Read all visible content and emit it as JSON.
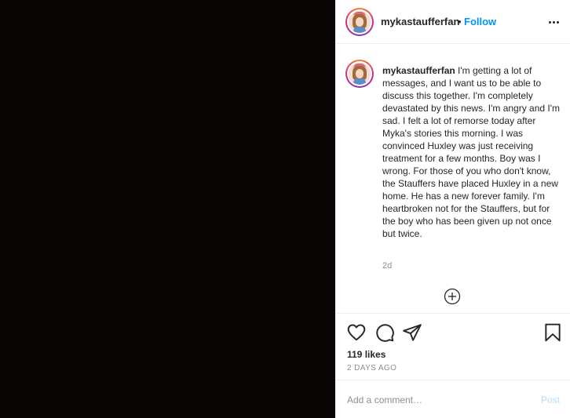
{
  "post": {
    "media": {
      "background": "#0b0606"
    },
    "header": {
      "username": "mykastaufferfan",
      "separator": "•",
      "follow_label": "Follow",
      "more_icon": "more-horizontal-icon"
    },
    "caption": {
      "username": "mykastaufferfan",
      "text": "I'm getting a lot of messages, and I want us to be able to discuss this together. I'm completely devastated by this news. I'm angry and I'm sad. I felt a lot of remorse today after Myka's stories this morning. I was convinced Huxley was just receiving treatment for a few months. Boy was I wrong. For those of you who don't know, the Stauffers have placed Huxley in a new home. He has a new forever family. I'm heartbroken not for the Stauffers, but for the boy who has been given up not once but twice.",
      "time": "2d"
    },
    "load_more_icon": "plus-circle-icon",
    "actions": {
      "icons": [
        "heart-icon",
        "comment-icon",
        "share-icon",
        "bookmark-icon"
      ],
      "likes": "119 likes",
      "date": "2 DAYS AGO"
    },
    "comment_box": {
      "placeholder": "Add a comment…",
      "post_label": "Post"
    },
    "colors": {
      "link_blue": "#0095f6",
      "post_disabled": "#b2dffc",
      "muted": "#8e8e8e"
    }
  }
}
